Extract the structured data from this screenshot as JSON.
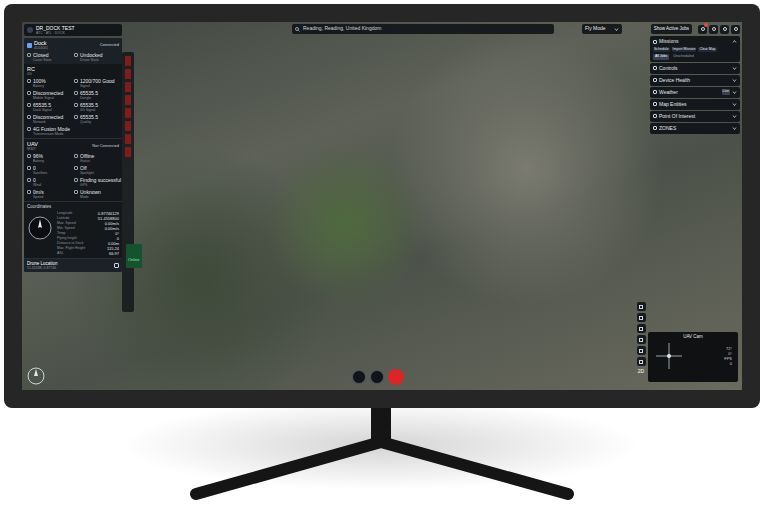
{
  "dock_header": {
    "title": "DR_DOCK TEST",
    "subtitle": "ATC · ATL · DOCK"
  },
  "search": {
    "value": "Reading, Reading, United Kingdom"
  },
  "fly_mode": "Fly Mode",
  "jobs_button": "Show Active Jobs",
  "dock": {
    "title": "Dock",
    "id": "4UJ4001",
    "status": "Connected",
    "fields": [
      {
        "value": "Closed",
        "label": "Cover State"
      },
      {
        "value": "Undocked",
        "label": "Drone State"
      }
    ]
  },
  "rc": {
    "title": "RC",
    "subtitle": "4G",
    "fields": [
      {
        "value": "100%",
        "label": "Battery"
      },
      {
        "value": "1200/700 Good",
        "label": "Signal"
      },
      {
        "value": "Disconnected",
        "label": "Mobile Signal"
      },
      {
        "value": "65535.5",
        "label": "Dongle"
      },
      {
        "value": "65535.5",
        "label": "Dock Signal"
      },
      {
        "value": "65535.5",
        "label": "4G Signal"
      },
      {
        "value": "Disconnected",
        "label": "Network"
      },
      {
        "value": "65535.5",
        "label": "Quality"
      },
      {
        "value": "4G Fusion Mode",
        "label": "Transmission Mode"
      }
    ]
  },
  "uav": {
    "title": "UAV",
    "subtitle": "M30T",
    "status": "Not Connected",
    "fields": [
      {
        "value": "96%",
        "label": "Battery"
      },
      {
        "value": "Offline",
        "label": "Status"
      },
      {
        "value": "0",
        "label": "Satellites"
      },
      {
        "value": "Off",
        "label": "Spotlight"
      },
      {
        "value": "0",
        "label": "Wind"
      },
      {
        "value": "Finding successful",
        "label": "GPS"
      },
      {
        "value": "0m/s",
        "label": "Speed"
      },
      {
        "value": "Unknown",
        "label": "Mode"
      }
    ]
  },
  "coordinates": {
    "title": "Coordinates",
    "rows": [
      {
        "label": "Longitude",
        "value": "0.87746129"
      },
      {
        "label": "Latitude",
        "value": "51.4558800"
      },
      {
        "label": "Max. Speed",
        "value": "0.00m/s"
      },
      {
        "label": "Min. Speed",
        "value": "0.00m/s"
      },
      {
        "label": "Temp",
        "value": "0°"
      },
      {
        "label": "Flying height",
        "value": "0"
      },
      {
        "label": "Distance to Dock",
        "value": "0.00m"
      },
      {
        "label": "Max. Flight Height",
        "value": "115.24"
      },
      {
        "label": "ASL",
        "value": "66.97"
      }
    ]
  },
  "drone_location": {
    "label": "Drone Location",
    "value": "51.45588, 0.87746"
  },
  "online_tab": "Online",
  "right_panel": [
    {
      "label": "Missions",
      "expanded": true
    },
    {
      "label": "Controls",
      "expanded": false
    },
    {
      "label": "Device Health",
      "expanded": false
    },
    {
      "label": "Weather",
      "expanded": false,
      "badge": "Live"
    },
    {
      "label": "Map Entities",
      "expanded": false
    },
    {
      "label": "Point Of Interest",
      "expanded": false
    },
    {
      "label": "ZONES",
      "expanded": false
    }
  ],
  "missions": {
    "actions": [
      "Schedule",
      "Import Mission",
      "Clear Map"
    ],
    "tabs": [
      {
        "label": "All Jobs",
        "selected": true
      },
      {
        "label": "Unscheduled",
        "selected": false
      }
    ]
  },
  "map_tools": {
    "mode": "2D"
  },
  "uav_cam": {
    "title": "UAV Cam",
    "readings": [
      "72°",
      "0°",
      "FPS",
      "0"
    ]
  }
}
